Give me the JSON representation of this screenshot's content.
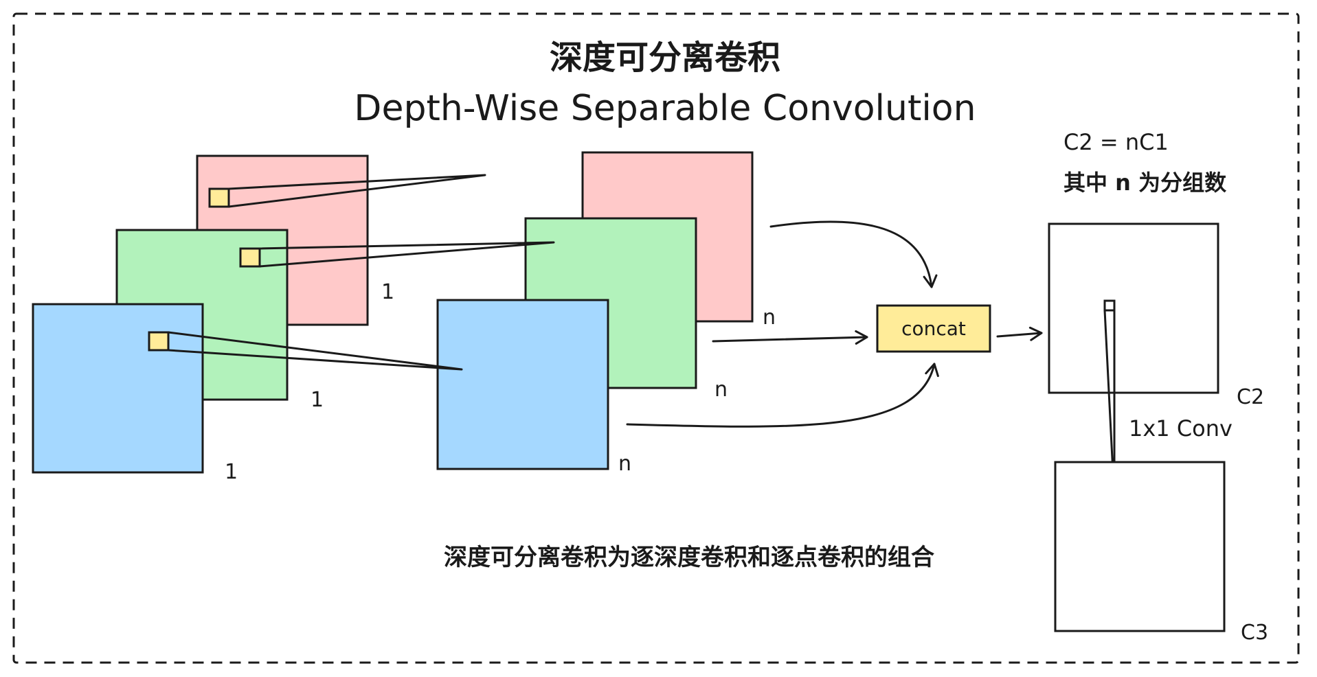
{
  "title": {
    "zh": "深度可分离卷积",
    "en": "Depth-Wise Separable Convolution"
  },
  "channel_labels": {
    "input_red": "1",
    "input_green": "1",
    "input_blue": "1",
    "output_red": "n",
    "output_green": "n",
    "output_blue": "n"
  },
  "concat_label": "concat",
  "formula": {
    "line1": "C2 = nC1",
    "line2": "其中 n 为分组数"
  },
  "pointwise": {
    "conv_label": "1x1 Conv",
    "c2_label": "C2",
    "c3_label": "C3"
  },
  "caption": "深度可分离卷积为逐深度卷积和逐点卷积的组合",
  "colors": {
    "red": "#ffc9c9",
    "green": "#b2f2bb",
    "blue": "#a5d8ff",
    "yellow": "#ffec99",
    "stroke": "#1a1a1a",
    "white": "#ffffff"
  }
}
